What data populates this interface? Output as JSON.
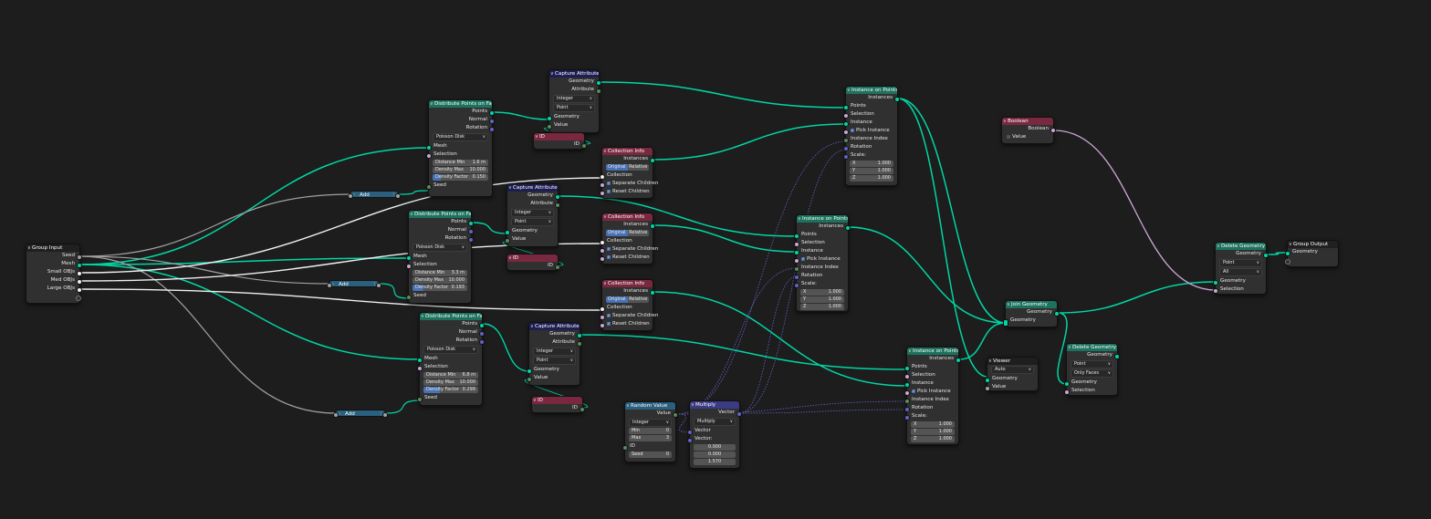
{
  "nodes": {
    "group_input": {
      "title": "Group Input",
      "seed": "Seed",
      "mesh": "Mesh",
      "small": "Small OBJs",
      "med": "Med OBJs",
      "large": "Large OBJs"
    },
    "dist1": {
      "title": "Distribute Points on Faces",
      "points": "Points",
      "normal": "Normal",
      "rotation": "Rotation",
      "mode": "Poisson Disk",
      "mesh": "Mesh",
      "selection": "Selection",
      "dist_min_label": "Distance Min",
      "dist_min": "1.6 m",
      "dens_max_label": "Density Max",
      "dens_max": "10.000",
      "dens_fac_label": "Density Factor",
      "dens_fac": "0.150",
      "seed": "Seed"
    },
    "dist2": {
      "title": "Distribute Points on Faces",
      "points": "Points",
      "normal": "Normal",
      "rotation": "Rotation",
      "mode": "Poisson Disk",
      "mesh": "Mesh",
      "selection": "Selection",
      "dist_min_label": "Distance Min",
      "dist_min": "3.3 m",
      "dens_max_label": "Density Max",
      "dens_max": "10.000",
      "dens_fac_label": "Density Factor",
      "dens_fac": "0.193",
      "seed": "Seed"
    },
    "dist3": {
      "title": "Distribute Points on Faces",
      "points": "Points",
      "normal": "Normal",
      "rotation": "Rotation",
      "mode": "Poisson Disk",
      "mesh": "Mesh",
      "selection": "Selection",
      "dist_min_label": "Distance Min",
      "dist_min": "6.8 m",
      "dens_max_label": "Density Max",
      "dens_max": "10.000",
      "dens_fac_label": "Density Factor",
      "dens_fac": "0.299",
      "seed": "Seed"
    },
    "cap1": {
      "title": "Capture Attribute",
      "geometry": "Geometry",
      "attribute": "Attribute",
      "type": "Integer",
      "domain": "Point",
      "geo_in": "Geometry",
      "value": "Value"
    },
    "cap2": {
      "title": "Capture Attribute",
      "geometry": "Geometry",
      "attribute": "Attribute",
      "type": "Integer",
      "domain": "Point",
      "geo_in": "Geometry",
      "value": "Value"
    },
    "cap3": {
      "title": "Capture Attribute",
      "geometry": "Geometry",
      "attribute": "Attribute",
      "type": "Integer",
      "domain": "Point",
      "geo_in": "Geometry",
      "value": "Value"
    },
    "id1": {
      "title": "ID",
      "id": "ID"
    },
    "id2": {
      "title": "ID",
      "id": "ID"
    },
    "id3": {
      "title": "ID",
      "id": "ID"
    },
    "coll1": {
      "title": "Collection Info",
      "instances": "Instances",
      "original": "Original",
      "relative": "Relative",
      "collection": "Collection",
      "sep": "Separate Children",
      "reset": "Reset Children"
    },
    "coll2": {
      "title": "Collection Info",
      "instances": "Instances",
      "original": "Original",
      "relative": "Relative",
      "collection": "Collection",
      "sep": "Separate Children",
      "reset": "Reset Children"
    },
    "coll3": {
      "title": "Collection Info",
      "instances": "Instances",
      "original": "Original",
      "relative": "Relative",
      "collection": "Collection",
      "sep": "Separate Children",
      "reset": "Reset Children"
    },
    "inst1": {
      "title": "Instance on Points",
      "instances": "Instances",
      "points": "Points",
      "selection": "Selection",
      "instance": "Instance",
      "pick": "Pick Instance",
      "index": "Instance Index",
      "rotation": "Rotation",
      "scale": "Scale:",
      "x": "X",
      "y": "Y",
      "z": "Z",
      "xv": "1.000",
      "yv": "1.000",
      "zv": "1.000"
    },
    "inst2": {
      "title": "Instance on Points",
      "instances": "Instances",
      "points": "Points",
      "selection": "Selection",
      "instance": "Instance",
      "pick": "Pick Instance",
      "index": "Instance Index",
      "rotation": "Rotation",
      "scale": "Scale:",
      "x": "X",
      "y": "Y",
      "z": "Z",
      "xv": "1.000",
      "yv": "1.000",
      "zv": "1.000"
    },
    "inst3": {
      "title": "Instance on Points",
      "instances": "Instances",
      "points": "Points",
      "selection": "Selection",
      "instance": "Instance",
      "pick": "Pick Instance",
      "index": "Instance Index",
      "rotation": "Rotation",
      "scale": "Scale:",
      "x": "X",
      "y": "Y",
      "z": "Z",
      "xv": "1.000",
      "yv": "1.000",
      "zv": "1.000"
    },
    "add1": {
      "title": "Add"
    },
    "add2": {
      "title": "Add"
    },
    "add3": {
      "title": "Add"
    },
    "random": {
      "title": "Random Value",
      "value": "Value",
      "type": "Integer",
      "min_label": "Min",
      "min": "0",
      "max_label": "Max",
      "max": "3",
      "id": "ID",
      "seed_label": "Seed",
      "seed": "0"
    },
    "multiply": {
      "title": "Multiply",
      "vector_out": "Vector",
      "op": "Multiply",
      "vector_in1": "Vector",
      "vector_in2": "Vector:",
      "v0": "0.000",
      "v1": "0.000",
      "v2": "1.570"
    },
    "boolean": {
      "title": "Boolean",
      "boolean": "Boolean",
      "value": "Value"
    },
    "join": {
      "title": "Join Geometry",
      "geometry_out": "Geometry",
      "geometry_in": "Geometry"
    },
    "viewer": {
      "title": "Viewer",
      "domain": "Auto",
      "geometry": "Geometry",
      "value": "Value"
    },
    "del1": {
      "title": "Delete Geometry",
      "geometry_out": "Geometry",
      "domain": "Point",
      "mode": "All",
      "geometry_in": "Geometry",
      "selection": "Selection"
    },
    "del2": {
      "title": "Delete Geometry",
      "geometry_out": "Geometry",
      "domain": "Point",
      "mode": "Only Faces",
      "geometry_in": "Geometry",
      "selection": "Selection"
    },
    "group_output": {
      "title": "Group Output",
      "geometry": "Geometry"
    }
  },
  "colors": {
    "background": "#1d1d1d",
    "geometry_link": "#00d6a3",
    "float_link": "#a1a1a1",
    "vector_link": "#6363c7",
    "boolean_link": "#cca6d6",
    "instance_link": "#f0f0f0"
  }
}
